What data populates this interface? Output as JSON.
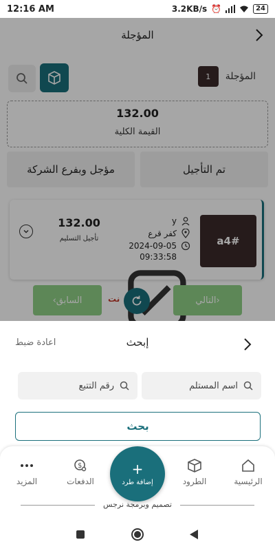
{
  "status_bar": {
    "time": "12:16 AM",
    "speed": "3.2KB/s",
    "battery": "24"
  },
  "header": {
    "title": "المؤجلة"
  },
  "toolbar": {
    "count_label": "المؤجلة",
    "count_value": "1"
  },
  "summary": {
    "total_value": "132.00",
    "total_label": "القيمة الكلية"
  },
  "status_tiles": [
    "تم التأجيل",
    "مؤجل وبفرع الشركة"
  ],
  "order": {
    "code": "a4#",
    "name": "y",
    "location": "كفر قرع",
    "date": "2024-09-05",
    "time": "09:33:58",
    "net_label": "نت",
    "price": "132.00",
    "price_note": "تأجيل التسليم"
  },
  "pager": {
    "prev_label": "السابق",
    "next_label": "التالي"
  },
  "search_sheet": {
    "title": "إبحث",
    "reset_label": "اعادة ضبط",
    "name_placeholder": "اسم المستلم",
    "tracking_placeholder": "رقم التتبع",
    "submit_label": "بحث"
  },
  "bottom_nav": {
    "home": "الرئيسية",
    "parcels": "الطرود",
    "add_parcel": "إضافة طرد",
    "payments": "الدفعات",
    "more": "المزيد"
  },
  "footer": {
    "credit": "تصميم وبرمجة نرجس"
  },
  "colors": {
    "primary": "#1a6f7b",
    "tag": "#3b2a2a",
    "pager": "#8fcf86",
    "danger": "#c0392b"
  }
}
